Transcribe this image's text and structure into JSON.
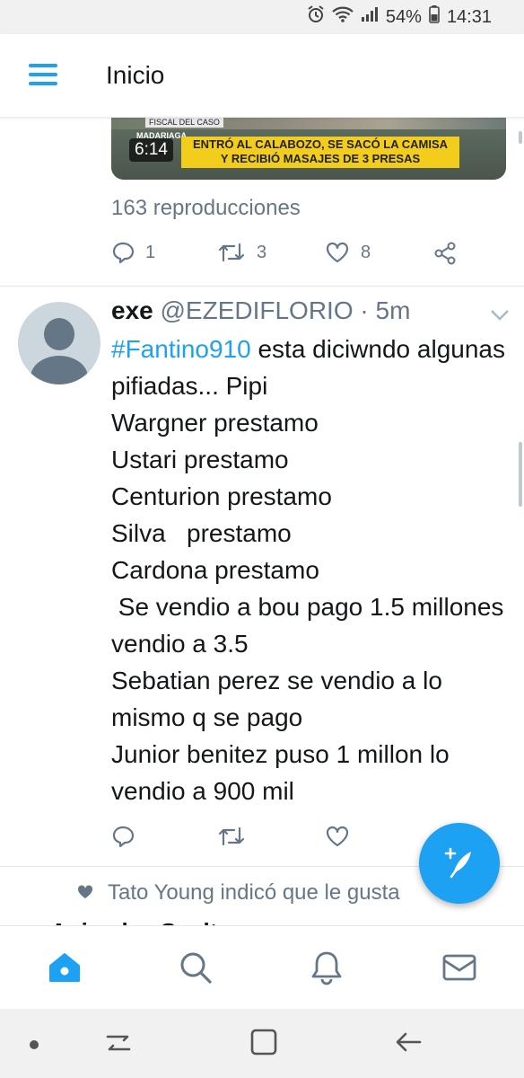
{
  "status_bar": {
    "battery": "54%",
    "time": "14:31"
  },
  "header": {
    "title": "Inicio"
  },
  "video_tweet": {
    "duration": "6:14",
    "overlay_small": "FISCAL DEL CASO",
    "overlay_place": "MADARIAGA",
    "banner_line1": "ENTRÓ AL CALABOZO, SE SACÓ LA CAMISA",
    "banner_line2": "Y RECIBIÓ MASAJES DE 3 PRESAS",
    "views": "163 reproducciones",
    "replies": "1",
    "retweets": "3",
    "likes": "8"
  },
  "tweet": {
    "name": "exe",
    "handle": "@EZEDIFLORIO",
    "time": "· 5m",
    "hashtag": "#Fantino910",
    "text": " esta diciwndo algunas pifiadas... Pipi\nWargner prestamo\nUstari prestamo\nCenturion prestamo\nSilva   prestamo\nCardona prestamo\n Se vendio a bou pago 1.5 millones vendio a 3.5\nSebatian perez se vendio a lo mismo q se pago\nJunior benitez puso 1 millon lo vendio a 900 mil"
  },
  "liked_notice": "Tato Young indicó que le gusta",
  "next_tweet_partial": "Animales Sueltos",
  "colors": {
    "accent": "#1da1f2",
    "secondary_text": "#657786"
  },
  "icons": {
    "nav": [
      "home-icon",
      "search-icon",
      "bell-icon",
      "mail-icon"
    ],
    "system": [
      "dot-icon",
      "recent-apps-icon",
      "home-square-icon",
      "back-icon"
    ]
  }
}
